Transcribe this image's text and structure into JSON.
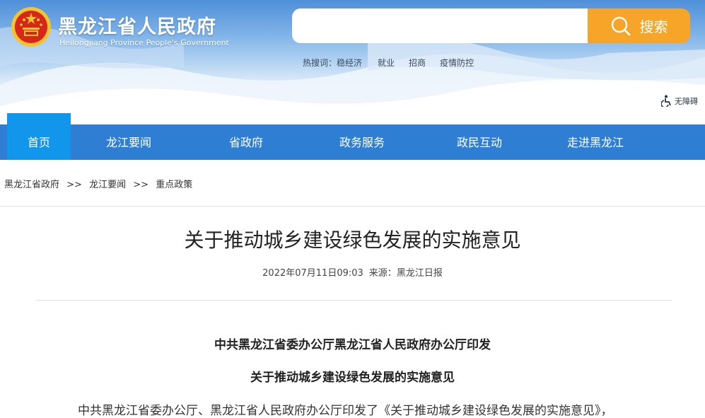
{
  "header": {
    "site_title": "黑龙江省人民政府",
    "site_subtitle": "Heilongjiang Province People's Government",
    "search": {
      "placeholder": "",
      "button_label": "搜索"
    },
    "hot_search": {
      "label": "热搜词：",
      "terms": [
        "稳经济",
        "就业",
        "招商",
        "疫情防控"
      ]
    },
    "accessibility_label": "无障碍"
  },
  "nav": {
    "items": [
      {
        "label": "首页",
        "active": true
      },
      {
        "label": "龙江要闻"
      },
      {
        "label": "省政府"
      },
      {
        "label": "政务服务"
      },
      {
        "label": "政民互动"
      },
      {
        "label": "走进黑龙江"
      }
    ]
  },
  "breadcrumb": {
    "items": [
      "黑龙江省政府",
      "龙江要闻",
      "重点政策"
    ],
    "separator": ">>"
  },
  "article": {
    "title": "关于推动城乡建设绿色发展的实施意见",
    "date": "2022年07月11日09:03",
    "source_label": "来源：",
    "source": "黑龙江日报",
    "issuer": "中共黑龙江省委办公厅黑龙江省人民政府办公厅印发",
    "doc_title": "关于推动城乡建设绿色发展的实施意见",
    "first_paragraph": "中共黑龙江省委办公厅、黑龙江省人民政府办公厅印发了《关于推动城乡建设绿色发展的实施意见》，"
  },
  "colors": {
    "nav_bg": "#2e7fd3",
    "nav_active": "#1296ec",
    "search_button": "#f6a528",
    "emblem_red": "#d7261c",
    "emblem_gold": "#f4c430"
  }
}
